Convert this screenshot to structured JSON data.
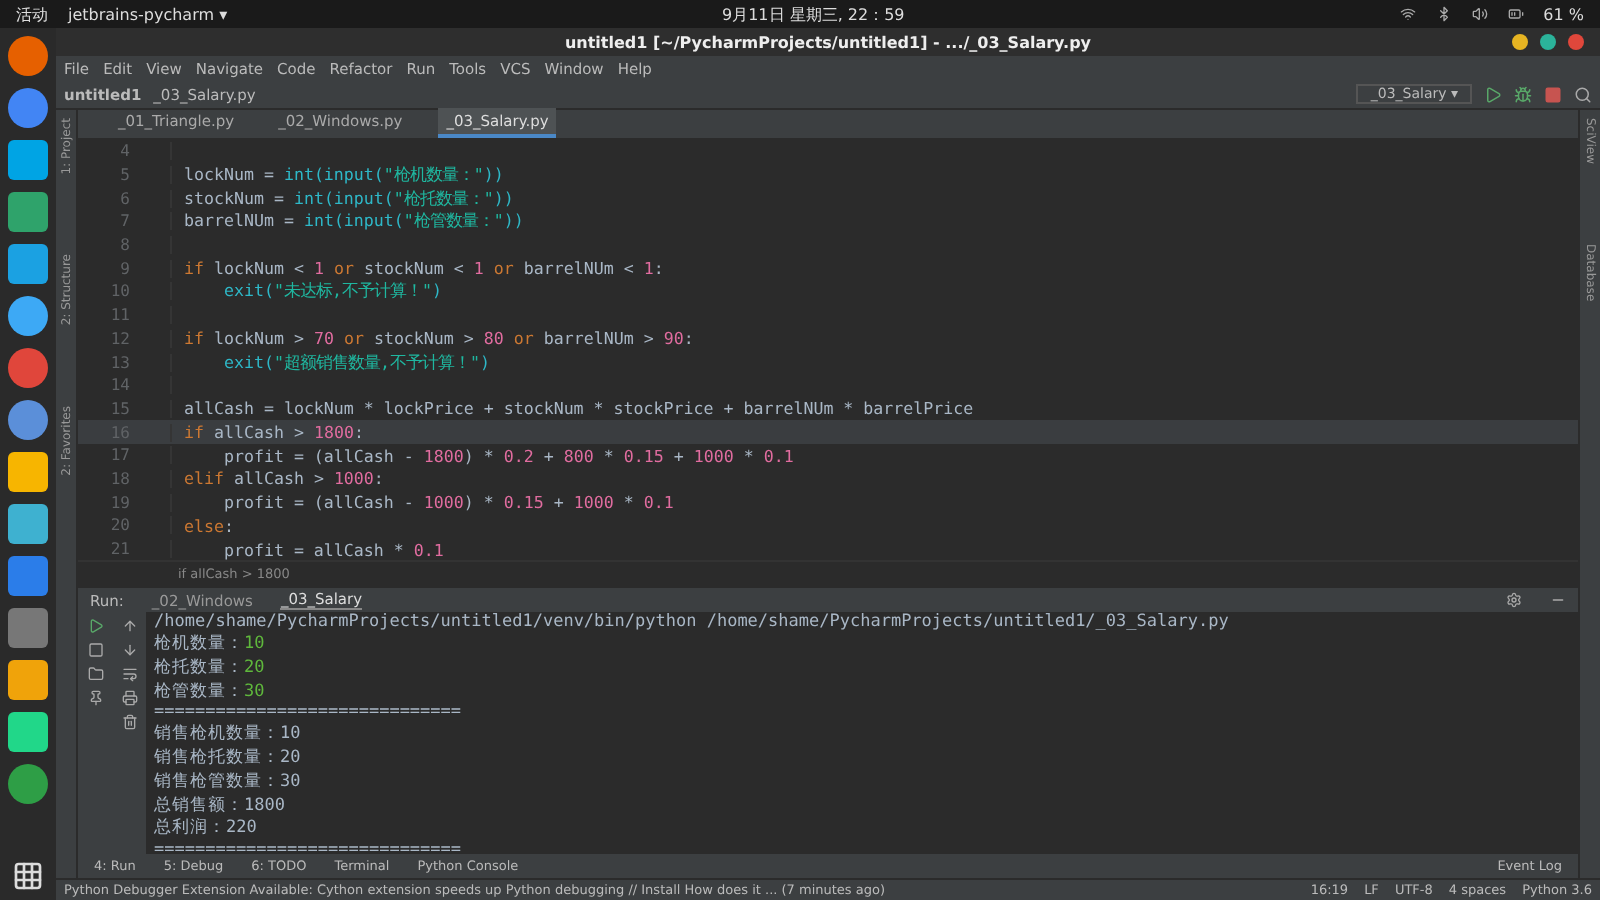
{
  "top_bar": {
    "activities": "活动",
    "app": "jetbrains-pycharm ▾",
    "clock": "9月11日 星期三, 22：59",
    "battery": "61 %"
  },
  "window": {
    "title": "untitled1 [~/PycharmProjects/untitled1] - .../_03_Salary.py"
  },
  "menu": [
    "File",
    "Edit",
    "View",
    "Navigate",
    "Code",
    "Refactor",
    "Run",
    "Tools",
    "VCS",
    "Window",
    "Help"
  ],
  "breadcrumb": [
    "untitled1",
    "_03_Salary.py"
  ],
  "run_config": "_03_Salary ▾",
  "side_left": [
    "1: Project",
    "2: Structure",
    "2: Favorites"
  ],
  "side_right": [
    "SciView",
    "Database"
  ],
  "tabs": [
    {
      "label": "_01_Triangle.py",
      "selected": false
    },
    {
      "label": "_02_Windows.py",
      "selected": false
    },
    {
      "label": "_03_Salary.py",
      "selected": true
    }
  ],
  "code": [
    {
      "no": "4",
      "current": false
    },
    {
      "no": "5",
      "current": false,
      "tokens": [
        {
          "kind": "plain",
          "text": "lockNum = "
        },
        {
          "kind": "fn",
          "text": "int(input("
        },
        {
          "kind": "str",
          "text": "\"枪机数量：\""
        },
        {
          "kind": "fn",
          "text": "))"
        }
      ]
    },
    {
      "no": "6",
      "current": false,
      "tokens": [
        {
          "kind": "plain",
          "text": "stockNum = "
        },
        {
          "kind": "fn",
          "text": "int(input("
        },
        {
          "kind": "str",
          "text": "\"枪托数量：\""
        },
        {
          "kind": "fn",
          "text": "))"
        }
      ]
    },
    {
      "no": "7",
      "current": false,
      "tokens": [
        {
          "kind": "plain",
          "text": "barrelNUm = "
        },
        {
          "kind": "fn",
          "text": "int(input("
        },
        {
          "kind": "str",
          "text": "\"枪管数量：\""
        },
        {
          "kind": "fn",
          "text": "))"
        }
      ]
    },
    {
      "no": "8",
      "current": false
    },
    {
      "no": "9",
      "current": false,
      "tokens": [
        {
          "kind": "kw",
          "text": "if"
        },
        {
          "kind": "plain",
          "text": " lockNum < "
        },
        {
          "kind": "num",
          "text": "1"
        },
        {
          "kind": "kw",
          "text": " or"
        },
        {
          "kind": "plain",
          "text": " stockNum < "
        },
        {
          "kind": "num",
          "text": "1"
        },
        {
          "kind": "kw",
          "text": " or"
        },
        {
          "kind": "plain",
          "text": " barrelNUm < "
        },
        {
          "kind": "num",
          "text": "1"
        },
        {
          "kind": "plain",
          "text": ":"
        }
      ]
    },
    {
      "no": "10",
      "current": false,
      "tokens": [
        {
          "kind": "fn",
          "text": "    exit("
        },
        {
          "kind": "str",
          "text": "\"未达标,不予计算！\""
        },
        {
          "kind": "fn",
          "text": ")"
        }
      ]
    },
    {
      "no": "11",
      "current": false
    },
    {
      "no": "12",
      "current": false,
      "tokens": [
        {
          "kind": "kw",
          "text": "if"
        },
        {
          "kind": "plain",
          "text": " lockNum > "
        },
        {
          "kind": "num",
          "text": "70"
        },
        {
          "kind": "kw",
          "text": " or"
        },
        {
          "kind": "plain",
          "text": " stockNum > "
        },
        {
          "kind": "num",
          "text": "80"
        },
        {
          "kind": "kw",
          "text": " or"
        },
        {
          "kind": "plain",
          "text": " barrelNUm > "
        },
        {
          "kind": "num",
          "text": "90"
        },
        {
          "kind": "plain",
          "text": ":"
        }
      ]
    },
    {
      "no": "13",
      "current": false,
      "tokens": [
        {
          "kind": "fn",
          "text": "    exit("
        },
        {
          "kind": "str",
          "text": "\"超额销售数量,不予计算！\""
        },
        {
          "kind": "fn",
          "text": ")"
        }
      ]
    },
    {
      "no": "14",
      "current": false
    },
    {
      "no": "15",
      "current": false,
      "tokens": [
        {
          "kind": "plain",
          "text": "allCash = lockNum * lockPrice + stockNum * stockPrice + barrelNUm * barrelPrice"
        }
      ]
    },
    {
      "no": "16",
      "current": true,
      "tokens": [
        {
          "kind": "kw",
          "text": "if"
        },
        {
          "kind": "plain",
          "text": " allCash > "
        },
        {
          "kind": "num",
          "text": "1800"
        },
        {
          "kind": "plain",
          "text": ":"
        }
      ]
    },
    {
      "no": "17",
      "current": false,
      "tokens": [
        {
          "kind": "plain",
          "text": "    profit = (allCash - "
        },
        {
          "kind": "num",
          "text": "1800"
        },
        {
          "kind": "plain",
          "text": ") * "
        },
        {
          "kind": "num",
          "text": "0.2"
        },
        {
          "kind": "plain",
          "text": " + "
        },
        {
          "kind": "num",
          "text": "800"
        },
        {
          "kind": "plain",
          "text": " * "
        },
        {
          "kind": "num",
          "text": "0.15"
        },
        {
          "kind": "plain",
          "text": " + "
        },
        {
          "kind": "num",
          "text": "1000"
        },
        {
          "kind": "plain",
          "text": " * "
        },
        {
          "kind": "num",
          "text": "0.1"
        }
      ]
    },
    {
      "no": "18",
      "current": false,
      "tokens": [
        {
          "kind": "kw",
          "text": "elif"
        },
        {
          "kind": "plain",
          "text": " allCash > "
        },
        {
          "kind": "num",
          "text": "1000"
        },
        {
          "kind": "plain",
          "text": ":"
        }
      ]
    },
    {
      "no": "19",
      "current": false,
      "tokens": [
        {
          "kind": "plain",
          "text": "    profit = (allCash - "
        },
        {
          "kind": "num",
          "text": "1000"
        },
        {
          "kind": "plain",
          "text": ") * "
        },
        {
          "kind": "num",
          "text": "0.15"
        },
        {
          "kind": "plain",
          "text": " + "
        },
        {
          "kind": "num",
          "text": "1000"
        },
        {
          "kind": "plain",
          "text": " * "
        },
        {
          "kind": "num",
          "text": "0.1"
        }
      ]
    },
    {
      "no": "20",
      "current": false,
      "tokens": [
        {
          "kind": "kw",
          "text": "else"
        },
        {
          "kind": "plain",
          "text": ":"
        }
      ]
    },
    {
      "no": "21",
      "current": false,
      "tokens": [
        {
          "kind": "plain",
          "text": "    profit = allCash * "
        },
        {
          "kind": "num",
          "text": "0.1"
        }
      ]
    }
  ],
  "code_breadcrumb": "if allCash > 1800",
  "run_panel": {
    "label": "Run:",
    "tabs": [
      {
        "label": "_02_Windows",
        "selected": false
      },
      {
        "label": "_03_Salary",
        "selected": true
      }
    ],
    "output": [
      {
        "kind": "plain",
        "text": "/home/shame/PycharmProjects/untitled1/venv/bin/python /home/shame/PycharmProjects/untitled1/_03_Salary.py"
      },
      {
        "kind": "input",
        "text": "枪机数量：",
        "value": "10"
      },
      {
        "kind": "input",
        "text": "枪托数量：",
        "value": "20"
      },
      {
        "kind": "input",
        "text": "枪管数量：",
        "value": "30"
      },
      {
        "kind": "plain",
        "text": "=============================="
      },
      {
        "kind": "plain",
        "text": "销售枪机数量：10"
      },
      {
        "kind": "plain",
        "text": "销售枪托数量：20"
      },
      {
        "kind": "plain",
        "text": "销售枪管数量：30"
      },
      {
        "kind": "plain",
        "text": "总销售额：1800"
      },
      {
        "kind": "plain",
        "text": "总利润：220"
      },
      {
        "kind": "plain",
        "text": "=============================="
      }
    ]
  },
  "tool_tabs": [
    "4: Run",
    "5: Debug",
    "6: TODO",
    "Terminal",
    "Python Console"
  ],
  "event_log": "Event Log",
  "status_bar": {
    "message": "Python Debugger Extension Available: Cython extension speeds up Python debugging // Install  How does it ... (7 minutes ago)",
    "items": [
      "16:19",
      "LF",
      "UTF-8",
      "4 spaces",
      "Python 3.6"
    ]
  }
}
